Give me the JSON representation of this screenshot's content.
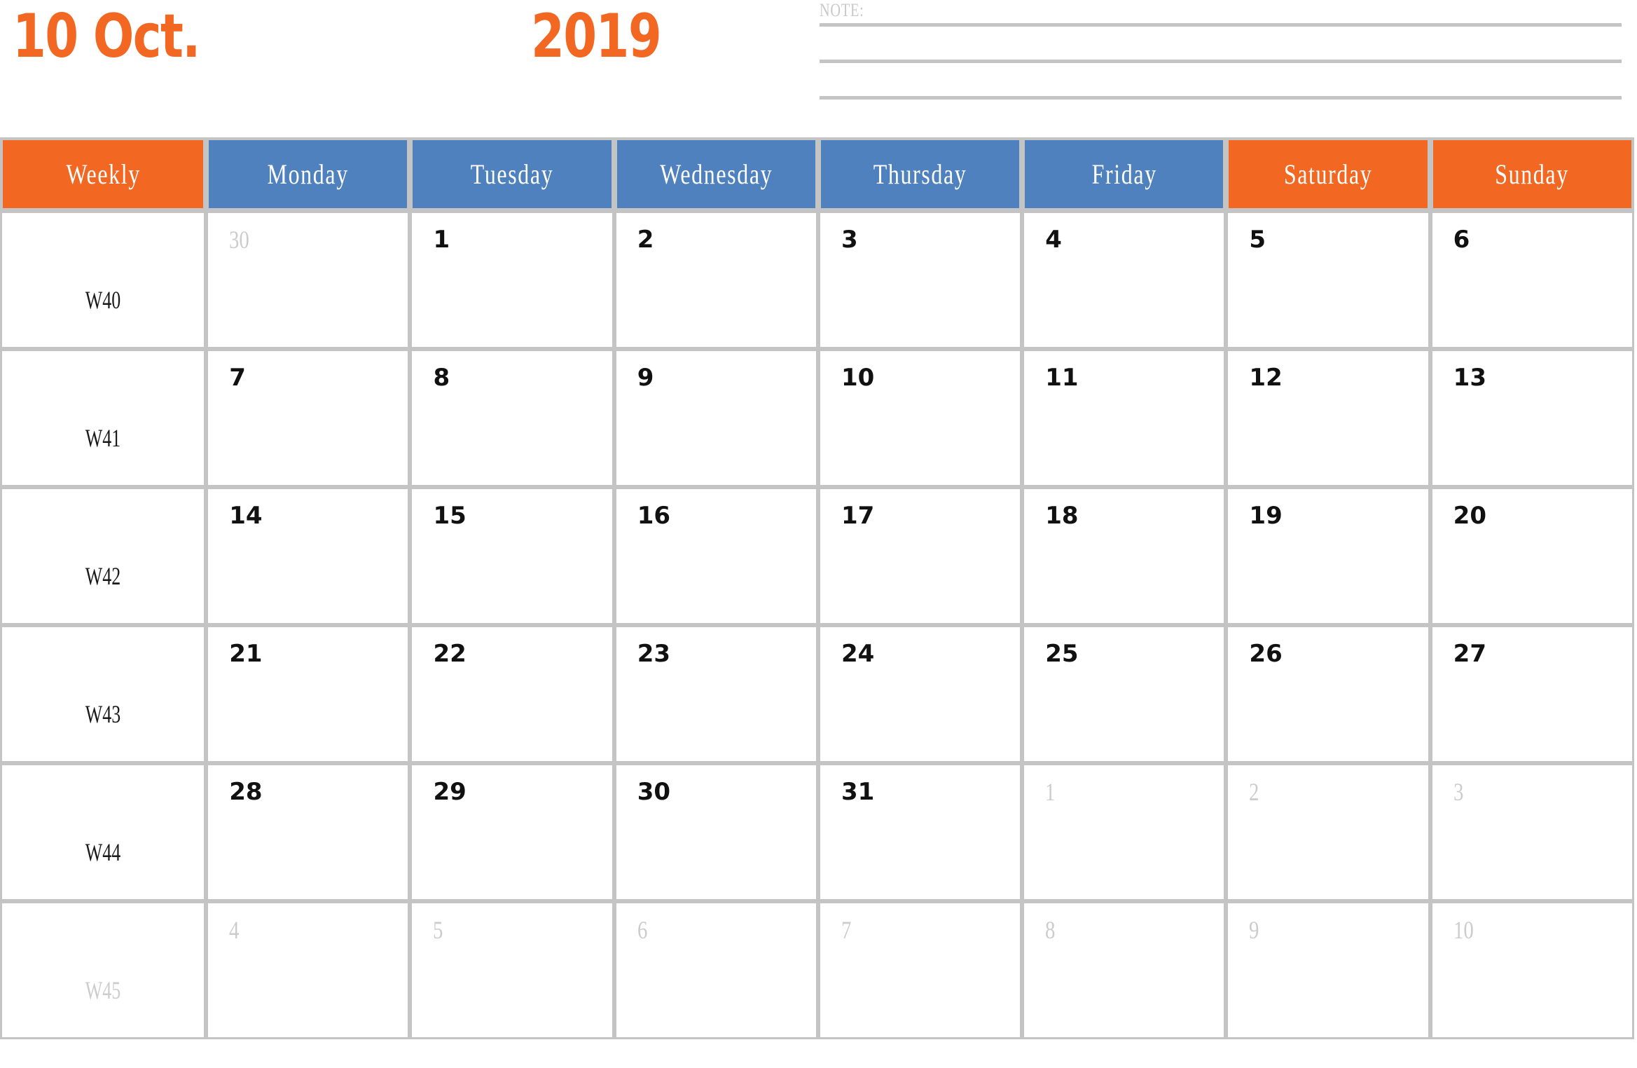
{
  "title": {
    "month": "10 Oct.",
    "year": "2019"
  },
  "note": {
    "label": "NOTE:",
    "lines": [
      "",
      "",
      ""
    ]
  },
  "colors": {
    "orange": "#F26822",
    "blue": "#4E81BD",
    "grid": "#c4c4c4",
    "muted": "#cccccc",
    "text": "#111111"
  },
  "table": {
    "headers": [
      {
        "label": "Weekly",
        "style": "weekly"
      },
      {
        "label": "Monday",
        "style": "weekday"
      },
      {
        "label": "Tuesday",
        "style": "weekday"
      },
      {
        "label": "Wednesday",
        "style": "weekday"
      },
      {
        "label": "Thursday",
        "style": "weekday"
      },
      {
        "label": "Friday",
        "style": "weekday"
      },
      {
        "label": "Saturday",
        "style": "weekend"
      },
      {
        "label": "Sunday",
        "style": "weekend"
      }
    ],
    "rows": [
      {
        "week": "W40",
        "week_muted": false,
        "days": [
          {
            "n": "30",
            "muted": true
          },
          {
            "n": "1",
            "muted": false
          },
          {
            "n": "2",
            "muted": false
          },
          {
            "n": "3",
            "muted": false
          },
          {
            "n": "4",
            "muted": false
          },
          {
            "n": "5",
            "muted": false
          },
          {
            "n": "6",
            "muted": false
          }
        ]
      },
      {
        "week": "W41",
        "week_muted": false,
        "days": [
          {
            "n": "7",
            "muted": false
          },
          {
            "n": "8",
            "muted": false
          },
          {
            "n": "9",
            "muted": false
          },
          {
            "n": "10",
            "muted": false
          },
          {
            "n": "11",
            "muted": false
          },
          {
            "n": "12",
            "muted": false
          },
          {
            "n": "13",
            "muted": false
          }
        ]
      },
      {
        "week": "W42",
        "week_muted": false,
        "days": [
          {
            "n": "14",
            "muted": false
          },
          {
            "n": "15",
            "muted": false
          },
          {
            "n": "16",
            "muted": false
          },
          {
            "n": "17",
            "muted": false
          },
          {
            "n": "18",
            "muted": false
          },
          {
            "n": "19",
            "muted": false
          },
          {
            "n": "20",
            "muted": false
          }
        ]
      },
      {
        "week": "W43",
        "week_muted": false,
        "days": [
          {
            "n": "21",
            "muted": false
          },
          {
            "n": "22",
            "muted": false
          },
          {
            "n": "23",
            "muted": false
          },
          {
            "n": "24",
            "muted": false
          },
          {
            "n": "25",
            "muted": false
          },
          {
            "n": "26",
            "muted": false
          },
          {
            "n": "27",
            "muted": false
          }
        ]
      },
      {
        "week": "W44",
        "week_muted": false,
        "days": [
          {
            "n": "28",
            "muted": false
          },
          {
            "n": "29",
            "muted": false
          },
          {
            "n": "30",
            "muted": false
          },
          {
            "n": "31",
            "muted": false
          },
          {
            "n": "1",
            "muted": true
          },
          {
            "n": "2",
            "muted": true
          },
          {
            "n": "3",
            "muted": true
          }
        ]
      },
      {
        "week": "W45",
        "week_muted": true,
        "days": [
          {
            "n": "4",
            "muted": true
          },
          {
            "n": "5",
            "muted": true
          },
          {
            "n": "6",
            "muted": true
          },
          {
            "n": "7",
            "muted": true
          },
          {
            "n": "8",
            "muted": true
          },
          {
            "n": "9",
            "muted": true
          },
          {
            "n": "10",
            "muted": true
          }
        ]
      }
    ]
  }
}
